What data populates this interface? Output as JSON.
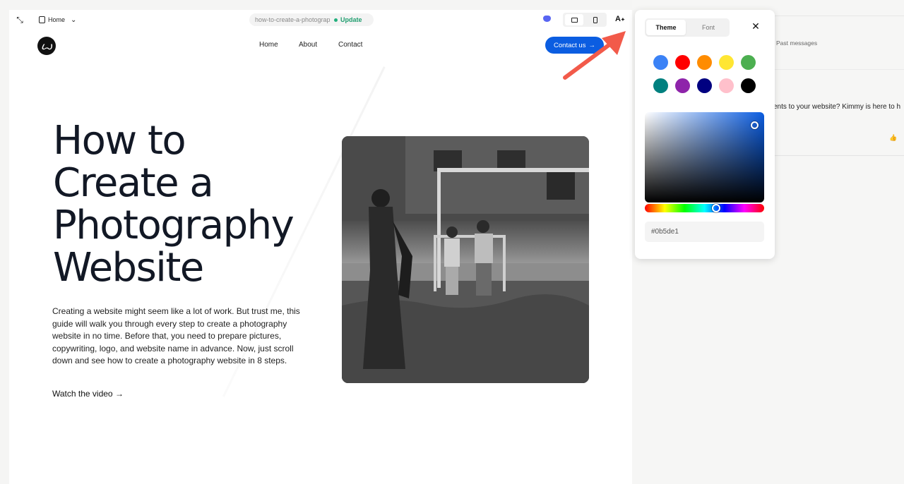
{
  "editor": {
    "page_selector": "Home",
    "url": "how-to-create-a-photography",
    "update_label": "Update"
  },
  "site": {
    "logo_letter": "ꙍ",
    "nav": [
      "Home",
      "About",
      "Contact"
    ],
    "contact_button": "Contact us",
    "hero_title": [
      "How to",
      "Create a",
      "Photography",
      "Website"
    ],
    "hero_body": "Creating a website might seem like a lot of work. But trust me, this guide will walk you through every step to create a photography website in no time. Before that, you need to prepare pictures, copywriting, logo, and website name in advance. Now, just scroll down and see how to create a photography website in 8 steps.",
    "watch_link": "Watch the video"
  },
  "chat": {
    "past_messages": "Past messages",
    "message_snippet": "ents to your website? Kimmy is here to h"
  },
  "theme_panel": {
    "tabs": [
      "Theme",
      "Font"
    ],
    "active_tab": "Theme",
    "swatches": [
      "#3b82f6",
      "#ff0000",
      "#ff8c00",
      "#ffe633",
      "#4caf50",
      "#00807f",
      "#8e24aa",
      "#000080",
      "#ffc0cb",
      "#000000"
    ],
    "picker_hue": "#0b5de1",
    "hex_value": "#0b5de1"
  }
}
